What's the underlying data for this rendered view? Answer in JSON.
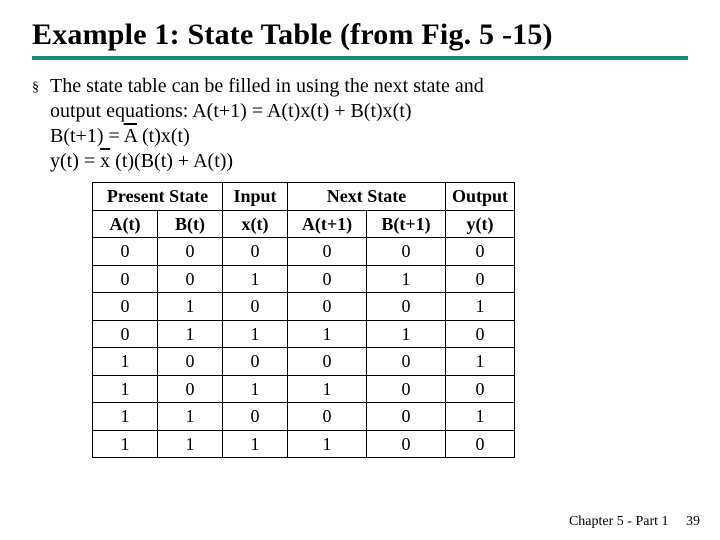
{
  "title": "Example 1: State Table (from Fig. 5 -15)",
  "bullet": {
    "line1a": "The state table can be filled in using the next state and",
    "line1b": "output equations: A(t+1) = A(t)x(t) + B(t)x(t)",
    "line2_pre": "B(t+1) = ",
    "line2_bar": "A",
    "line2_post": " (t)x(t)",
    "line3_pre": "y(t) = ",
    "line3_bar": "x",
    "line3_post": " (t)(B(t) + A(t))"
  },
  "table": {
    "groups": {
      "present": "Present State",
      "input": "Input",
      "next": "Next State",
      "output": "Output"
    },
    "cols": {
      "At": "A(t)",
      "Bt": "B(t)",
      "xt": "x(t)",
      "At1": "A(t+1)",
      "Bt1": "B(t+1)",
      "yt": "y(t)"
    },
    "rows": [
      {
        "At": "0",
        "Bt": "0",
        "xt": "0",
        "At1": "0",
        "Bt1": "0",
        "yt": "0"
      },
      {
        "At": "0",
        "Bt": "0",
        "xt": "1",
        "At1": "0",
        "Bt1": "1",
        "yt": "0"
      },
      {
        "At": "0",
        "Bt": "1",
        "xt": "0",
        "At1": "0",
        "Bt1": "0",
        "yt": "1"
      },
      {
        "At": "0",
        "Bt": "1",
        "xt": "1",
        "At1": "1",
        "Bt1": "1",
        "yt": "0"
      },
      {
        "At": "1",
        "Bt": "0",
        "xt": "0",
        "At1": "0",
        "Bt1": "0",
        "yt": "1"
      },
      {
        "At": "1",
        "Bt": "0",
        "xt": "1",
        "At1": "1",
        "Bt1": "0",
        "yt": "0"
      },
      {
        "At": "1",
        "Bt": "1",
        "xt": "0",
        "At1": "0",
        "Bt1": "0",
        "yt": "1"
      },
      {
        "At": "1",
        "Bt": "1",
        "xt": "1",
        "At1": "1",
        "Bt1": "0",
        "yt": "0"
      }
    ]
  },
  "footer": {
    "chapter": "Chapter 5 - Part 1",
    "page": "39"
  }
}
